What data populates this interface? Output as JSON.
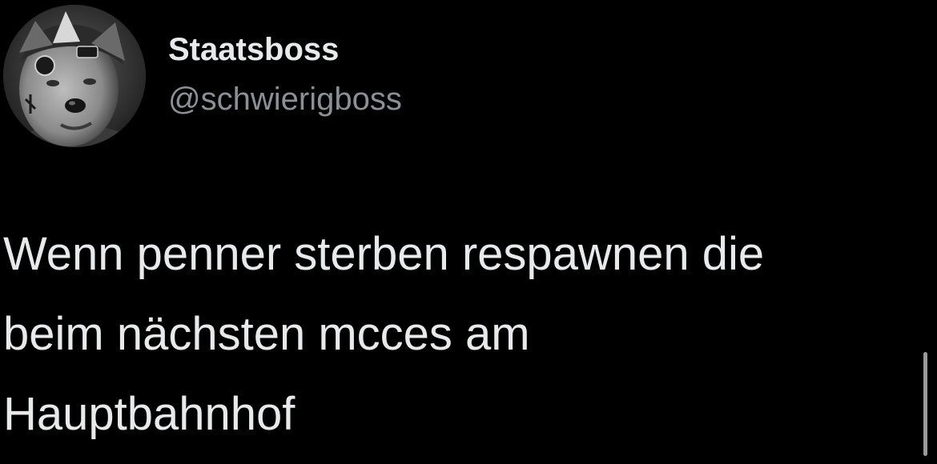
{
  "user": {
    "display_name": "Staatsboss",
    "handle": "@schwierigboss",
    "avatar_icon": "profile-photo-dog-filter"
  },
  "tweet": {
    "lines": [
      "Wenn penner sterben respawnen die",
      "beim nächsten mcces am",
      "Hauptbahnhof"
    ]
  },
  "colors": {
    "background": "#000000",
    "text": "#e7e9ea",
    "handle": "#8b9096"
  }
}
